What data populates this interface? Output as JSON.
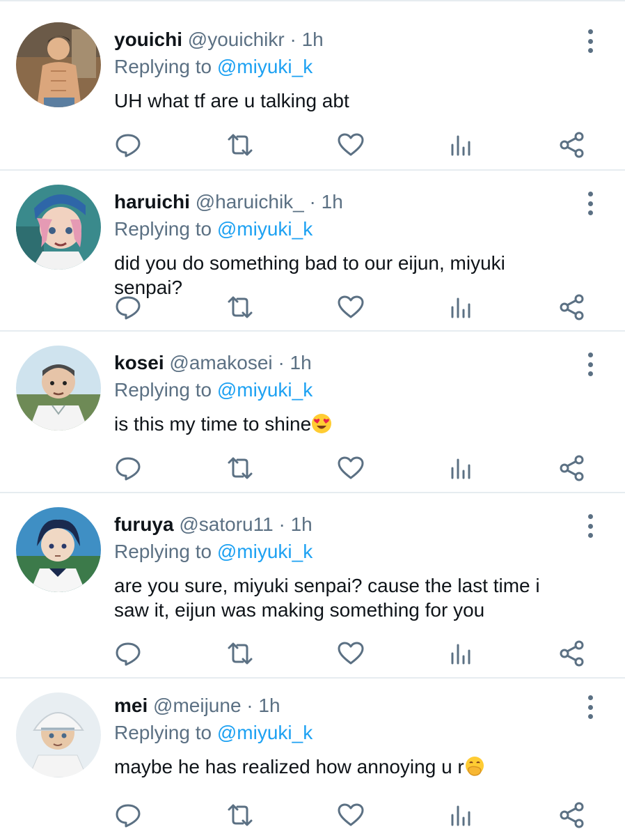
{
  "tweets": [
    {
      "name": "youichi",
      "handle": "@youichikr",
      "dot": "·",
      "time": "1h",
      "replying_prefix": "Replying to",
      "replying_to": "@miyuki_k",
      "text": "UH what tf are u talking abt",
      "emoji": ""
    },
    {
      "name": "haruichi",
      "handle": "@haruichik_",
      "dot": "·",
      "time": "1h",
      "replying_prefix": "Replying to",
      "replying_to": "@miyuki_k",
      "text": "did you do something bad to our eijun, miyuki senpai?",
      "emoji": ""
    },
    {
      "name": "kosei",
      "handle": "@amakosei",
      "dot": "·",
      "time": "1h",
      "replying_prefix": "Replying to",
      "replying_to": "@miyuki_k",
      "text": "is this my time to shine",
      "emoji": "heart-eyes-emoji"
    },
    {
      "name": "furuya",
      "handle": "@satoru11",
      "dot": "·",
      "time": "1h",
      "replying_prefix": "Replying to",
      "replying_to": "@miyuki_k",
      "text": "are you sure, miyuki senpai? cause the last time i saw it, eijun was making something for you",
      "emoji": ""
    },
    {
      "name": "mei",
      "handle": "@meijune",
      "dot": "·",
      "time": "1h",
      "replying_prefix": "Replying to",
      "replying_to": "@miyuki_k",
      "text": "maybe he has realized how annoying u r",
      "emoji": "face-with-hand-over-mouth-emoji"
    }
  ],
  "icons": {
    "reply": "reply-icon",
    "retweet": "retweet-icon",
    "like": "like-icon",
    "stats": "stats-icon",
    "share": "share-icon",
    "more": "more-vertical-icon"
  },
  "colors": {
    "name": "#0f1419",
    "secondary": "#5b7083",
    "mention": "#1da1f2",
    "divider": "#e6ecf0"
  }
}
